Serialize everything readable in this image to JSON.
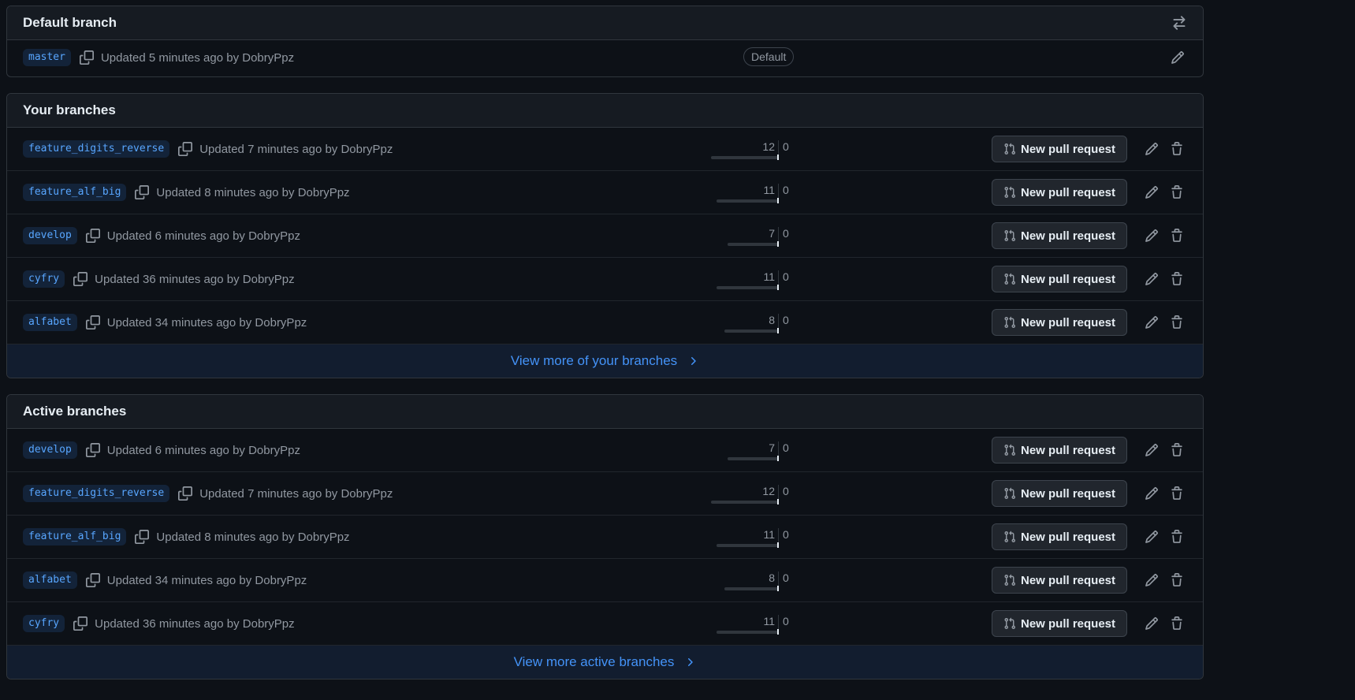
{
  "default_section": {
    "title": "Default branch",
    "branch": {
      "name": "master",
      "updated": "Updated 5 minutes ago by DobryPpz",
      "badge": "Default"
    }
  },
  "your_section": {
    "title": "Your branches",
    "view_more": "View more of your branches",
    "branches": [
      {
        "name": "feature_digits_reverse",
        "updated": "Updated 7 minutes ago by DobryPpz",
        "behind": "12",
        "ahead": "0",
        "behind_frac": 1.0
      },
      {
        "name": "feature_alf_big",
        "updated": "Updated 8 minutes ago by DobryPpz",
        "behind": "11",
        "ahead": "0",
        "behind_frac": 0.92
      },
      {
        "name": "develop",
        "updated": "Updated 6 minutes ago by DobryPpz",
        "behind": "7",
        "ahead": "0",
        "behind_frac": 0.75
      },
      {
        "name": "cyfry",
        "updated": "Updated 36 minutes ago by DobryPpz",
        "behind": "11",
        "ahead": "0",
        "behind_frac": 0.92
      },
      {
        "name": "alfabet",
        "updated": "Updated 34 minutes ago by DobryPpz",
        "behind": "8",
        "ahead": "0",
        "behind_frac": 0.8
      }
    ]
  },
  "active_section": {
    "title": "Active branches",
    "view_more": "View more active branches",
    "branches": [
      {
        "name": "develop",
        "updated": "Updated 6 minutes ago by DobryPpz",
        "behind": "7",
        "ahead": "0",
        "behind_frac": 0.75
      },
      {
        "name": "feature_digits_reverse",
        "updated": "Updated 7 minutes ago by DobryPpz",
        "behind": "12",
        "ahead": "0",
        "behind_frac": 1.0
      },
      {
        "name": "feature_alf_big",
        "updated": "Updated 8 minutes ago by DobryPpz",
        "behind": "11",
        "ahead": "0",
        "behind_frac": 0.92
      },
      {
        "name": "alfabet",
        "updated": "Updated 34 minutes ago by DobryPpz",
        "behind": "8",
        "ahead": "0",
        "behind_frac": 0.8
      },
      {
        "name": "cyfry",
        "updated": "Updated 36 minutes ago by DobryPpz",
        "behind": "11",
        "ahead": "0",
        "behind_frac": 0.92
      }
    ]
  },
  "actions": {
    "new_pr_label": "New pull request"
  },
  "icons": {
    "switch": "arrow-switch-icon",
    "copy": "copy-icon",
    "edit": "pencil-icon",
    "delete": "trash-icon",
    "pr": "git-pull-request-icon",
    "chevron": "chevron-right-icon"
  },
  "colors": {
    "accent": "#4493f8",
    "branch_bg": "rgba(56,139,253,0.15)",
    "bg": "#0d1117",
    "header_bg": "#161b22"
  }
}
